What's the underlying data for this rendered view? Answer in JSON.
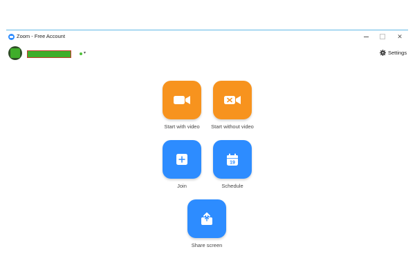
{
  "titlebar": {
    "title": "Zoom - Free Account",
    "icons": {
      "app": "zoom-logo-icon",
      "minimize": "minimize-icon",
      "maximize": "maximize-icon",
      "close": "close-icon"
    },
    "close_glyph": "✕"
  },
  "header": {
    "status_caret": "▾",
    "settings_label": "Settings",
    "settings_icon": "gear-icon"
  },
  "actions": [
    {
      "label": "Start with video",
      "icon": "video-camera-icon",
      "color": "#f7931e"
    },
    {
      "label": "Start without video",
      "icon": "video-camera-off-icon",
      "color": "#f7931e"
    },
    {
      "label": "Join",
      "icon": "plus-icon",
      "color": "#2d8cff"
    },
    {
      "label": "Schedule",
      "icon": "calendar-icon",
      "color": "#2d8cff",
      "calendar_day": "19"
    },
    {
      "label": "Share screen",
      "icon": "share-screen-icon",
      "color": "#2d8cff"
    }
  ]
}
